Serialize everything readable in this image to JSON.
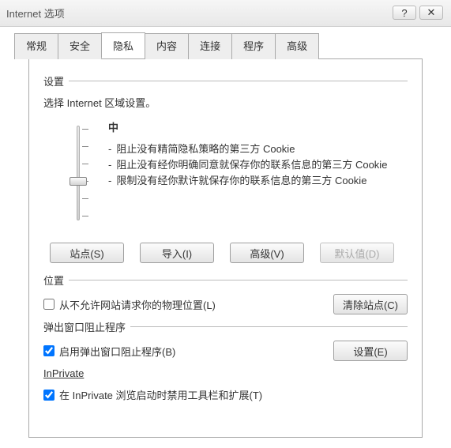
{
  "window": {
    "title": "Internet 选项"
  },
  "tabs": {
    "general": "常规",
    "security": "安全",
    "privacy": "隐私",
    "content": "内容",
    "connections": "连接",
    "programs": "程序",
    "advanced": "高级"
  },
  "settings": {
    "heading": "设置",
    "desc": "选择 Internet 区域设置。",
    "level": "中",
    "bullet1": "阻止没有精简隐私策略的第三方 Cookie",
    "bullet2": "阻止没有经你明确同意就保存你的联系信息的第三方 Cookie",
    "bullet3": "限制没有经你默许就保存你的联系信息的第三方 Cookie",
    "btn_sites": "站点(S)",
    "btn_import": "导入(I)",
    "btn_advanced": "高级(V)",
    "btn_default": "默认值(D)"
  },
  "location": {
    "heading": "位置",
    "chk_label": "从不允许网站请求你的物理位置(L)",
    "btn_clear": "清除站点(C)"
  },
  "popup": {
    "heading": "弹出窗口阻止程序",
    "chk_label": "启用弹出窗口阻止程序(B)",
    "btn_settings": "设置(E)"
  },
  "inprivate": {
    "heading": "InPrivate",
    "chk_label": "在 InPrivate 浏览启动时禁用工具栏和扩展(T)"
  }
}
